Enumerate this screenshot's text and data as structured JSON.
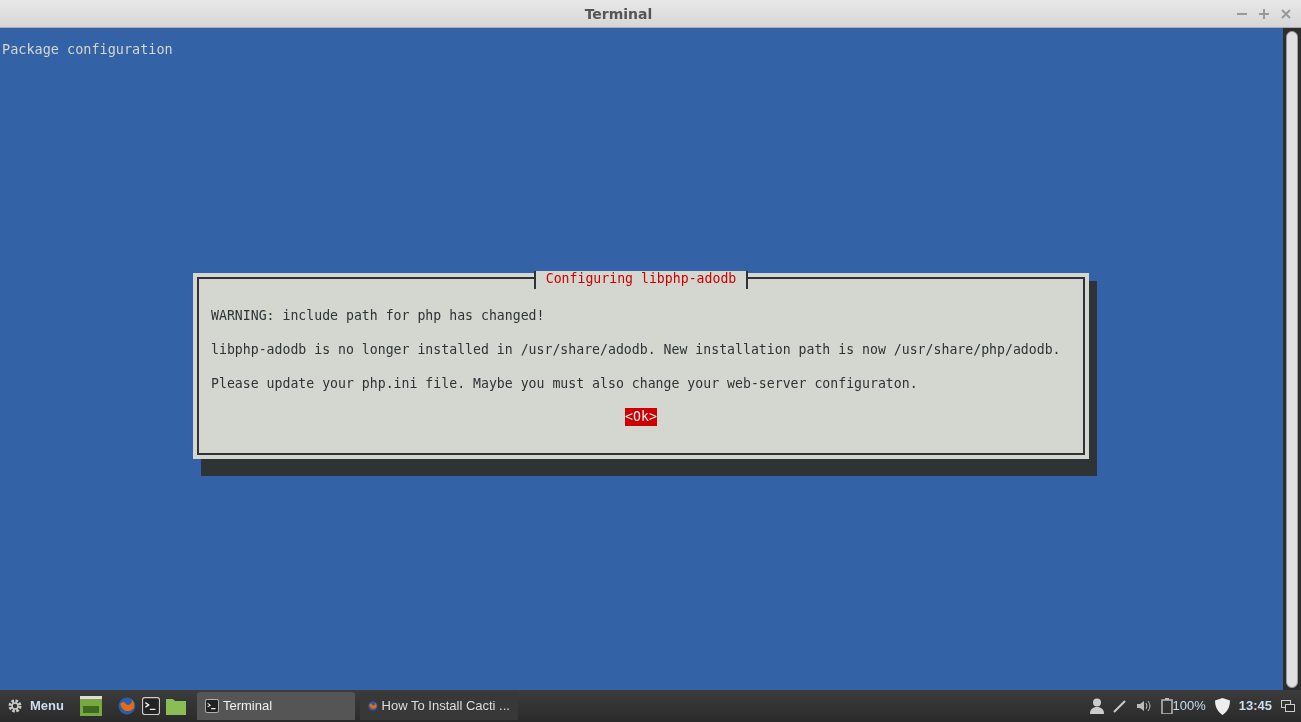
{
  "window": {
    "title": "Terminal"
  },
  "terminal": {
    "header": "Package configuration",
    "dialog": {
      "title": "Configuring libphp-adodb",
      "lines": [
        "WARNING: include path for php has changed!",
        "libphp-adodb is no longer installed in /usr/share/adodb. New installation path is now /usr/share/php/adodb.",
        "Please update your php.ini file. Maybe you must also change your web-server configuraton."
      ],
      "button": "<Ok>"
    }
  },
  "taskbar": {
    "menu": "Menu",
    "tasks": [
      {
        "label": "Terminal",
        "kind": "terminal",
        "selected": true
      },
      {
        "label": "How To Install Cacti ...",
        "kind": "browser",
        "selected": false
      }
    ],
    "battery": "100%",
    "clock": "13:45"
  }
}
